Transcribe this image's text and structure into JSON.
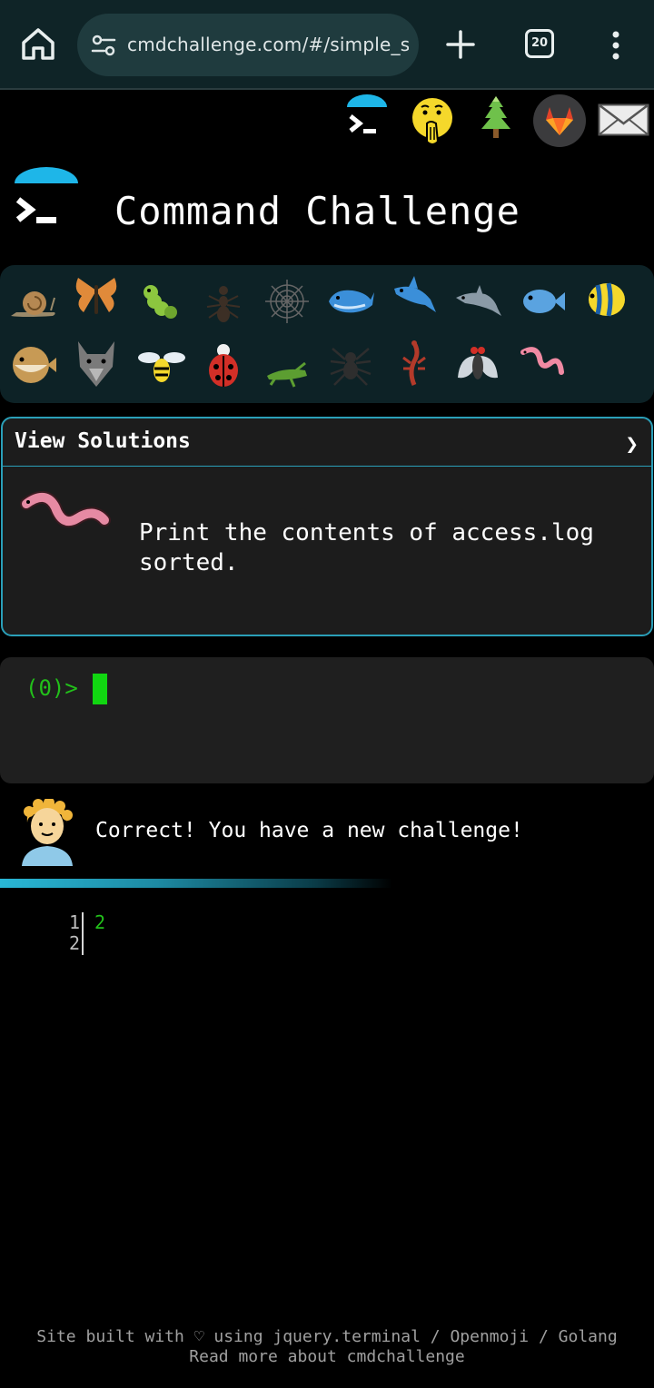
{
  "browser": {
    "url": "cmdchallenge.com/#/simple_sor",
    "tab_count": "20"
  },
  "top_icons": [
    "terminal-icon",
    "face-hand-over-mouth-icon",
    "tree-icon",
    "gitlab-icon",
    "mail-icon"
  ],
  "header": {
    "title": "Command Challenge"
  },
  "bugs": [
    "snail",
    "butterfly",
    "caterpillar",
    "ant",
    "spider-web",
    "whale",
    "shark",
    "dolphin",
    "fish",
    "tropical-fish",
    "pufferfish",
    "wolf",
    "bee",
    "ladybug",
    "cricket",
    "spider",
    "scorpion",
    "fly",
    "worm"
  ],
  "challenge": {
    "view_solutions_label": "View Solutions",
    "chevron": "❯",
    "description_line1": "Print the contents of access.log",
    "description_line2": "sorted."
  },
  "terminal": {
    "prompt": "(0)>"
  },
  "feedback": {
    "message": "Correct! You have a new challenge!"
  },
  "output": {
    "line_numbers": [
      "1",
      "2"
    ],
    "lines": [
      "2"
    ]
  },
  "footer": {
    "line1": "Site built with ♡ using jquery.terminal / Openmoji / Golang",
    "line2": "Read more about cmdchallenge"
  },
  "colors": {
    "accent": "#2a9fb8",
    "prompt_green": "#22c01a",
    "cursor_green": "#11d611"
  }
}
